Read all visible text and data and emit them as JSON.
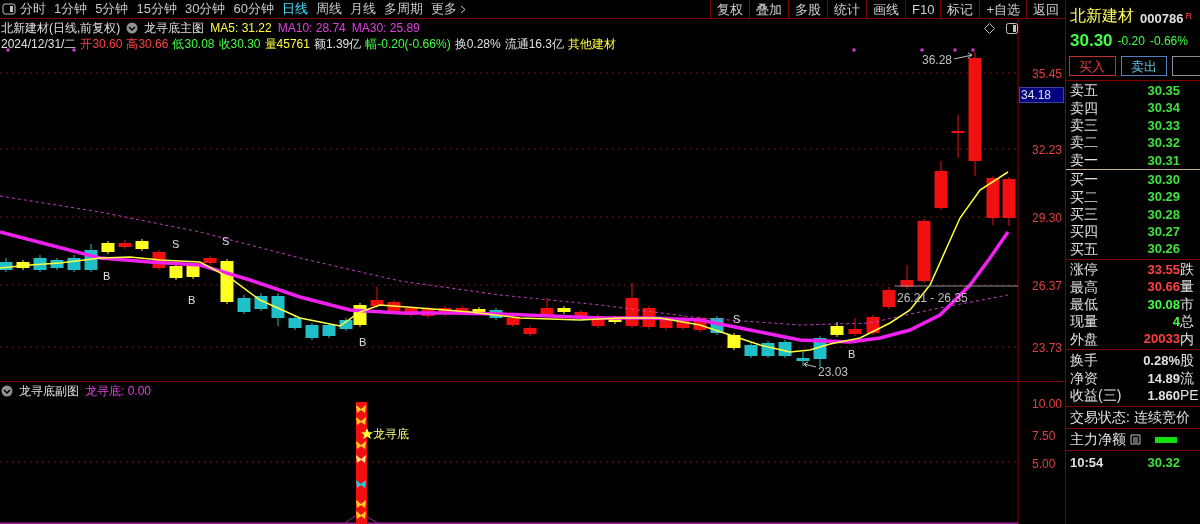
{
  "toolbar": {
    "periods": [
      {
        "label": "分时",
        "selected": false
      },
      {
        "label": "1分钟",
        "selected": false
      },
      {
        "label": "5分钟",
        "selected": false
      },
      {
        "label": "15分钟",
        "selected": false
      },
      {
        "label": "30分钟",
        "selected": false
      },
      {
        "label": "60分钟",
        "selected": false
      },
      {
        "label": "日线",
        "selected": true
      },
      {
        "label": "周线",
        "selected": false
      },
      {
        "label": "月线",
        "selected": false
      },
      {
        "label": "多周期",
        "selected": false
      }
    ],
    "more": "更多",
    "actions": [
      "复权",
      "叠加",
      "多股",
      "统计",
      "画线",
      "F10",
      "标记",
      "+自选",
      "返回"
    ]
  },
  "chart": {
    "title": "北新建材(日线,前复权)",
    "indicator": "龙寻底主图",
    "moving_averages": [
      {
        "text": "MA5: 31.22",
        "color": "#ffff40"
      },
      {
        "text": "MA10: 28.74",
        "color": "#e040e0"
      },
      {
        "text": "MA30: 25.89",
        "color": "#e040e0"
      }
    ],
    "quote": [
      {
        "text": "2024/12/31/二",
        "color": "#e0e0e0"
      },
      {
        "text": "开30.60",
        "color": "#ff4040"
      },
      {
        "text": "高30.66",
        "color": "#ff4040"
      },
      {
        "text": "低30.08",
        "color": "#40ff40"
      },
      {
        "text": "收30.30",
        "color": "#40ff40"
      },
      {
        "text": "量45761",
        "color": "#ffff40"
      },
      {
        "text": "额1.39亿",
        "color": "#e0e0e0"
      },
      {
        "text": "幅-0.20(-0.66%)",
        "color": "#40ff40"
      },
      {
        "text": "换0.28%",
        "color": "#e0e0e0"
      },
      {
        "text": "流通16.3亿",
        "color": "#e0e0e0"
      },
      {
        "text": "其他建材",
        "color": "#ffff40"
      }
    ],
    "price_ticks": [
      "35.45",
      "32.23",
      "29.30",
      "26.37",
      "23.73"
    ],
    "cursor_price": "34.18",
    "signals": [
      {
        "text": "S"
      },
      {
        "text": "S"
      },
      {
        "text": "B"
      },
      {
        "text": "B"
      },
      {
        "text": "B"
      },
      {
        "text": "S"
      },
      {
        "text": "B"
      }
    ],
    "annotations": {
      "high": "36.28",
      "low": "23.03",
      "range": "26.21 - 26.35"
    }
  },
  "sub_chart": {
    "title": "龙寻底副图",
    "indicator_value": "龙寻底: 0.00",
    "ticks": [
      "10.00",
      "7.50",
      "5.00"
    ],
    "signal_label": "龙寻底"
  },
  "quote_panel": {
    "name": "北新建材",
    "code": "000786",
    "badge": "R",
    "price": "30.30",
    "change": "-0.20",
    "change_pct": "-0.66%",
    "buttons": [
      {
        "label": "买入",
        "kind": "buy"
      },
      {
        "label": "卖出",
        "kind": "sell"
      },
      {
        "kind": "cut"
      }
    ],
    "asks": [
      {
        "label": "卖五",
        "price": "30.35"
      },
      {
        "label": "卖四",
        "price": "30.34"
      },
      {
        "label": "卖三",
        "price": "30.33"
      },
      {
        "label": "卖二",
        "price": "30.32"
      },
      {
        "label": "卖一",
        "price": "30.31"
      }
    ],
    "bids": [
      {
        "label": "买一",
        "price": "30.30"
      },
      {
        "label": "买二",
        "price": "30.29"
      },
      {
        "label": "买三",
        "price": "30.28"
      },
      {
        "label": "买四",
        "price": "30.27"
      },
      {
        "label": "买五",
        "price": "30.26"
      }
    ],
    "stats": [
      {
        "label": "涨停",
        "value": "33.55",
        "color": "#ff4040",
        "side": "跌"
      },
      {
        "label": "最高",
        "value": "30.66",
        "color": "#ff4040",
        "side": "量"
      },
      {
        "label": "最低",
        "value": "30.08",
        "color": "#40ff40",
        "side": "市"
      },
      {
        "label": "现量",
        "value": "4",
        "color": "#40ff40",
        "side": "总"
      },
      {
        "label": "外盘",
        "value": "20033",
        "color": "#ff4040",
        "side": "内"
      }
    ],
    "fundamentals": [
      {
        "label": "换手",
        "value": "0.28%",
        "side": "股"
      },
      {
        "label": "净资",
        "value": "14.89",
        "side": "流"
      },
      {
        "label": "收益(三)",
        "value": "1.860",
        "side": "PE"
      }
    ],
    "trade_status": "交易状态: 连续竞价",
    "main_net_label": "主力净额",
    "ticks": [
      {
        "time": "10:54",
        "price": "30.32"
      }
    ]
  }
}
